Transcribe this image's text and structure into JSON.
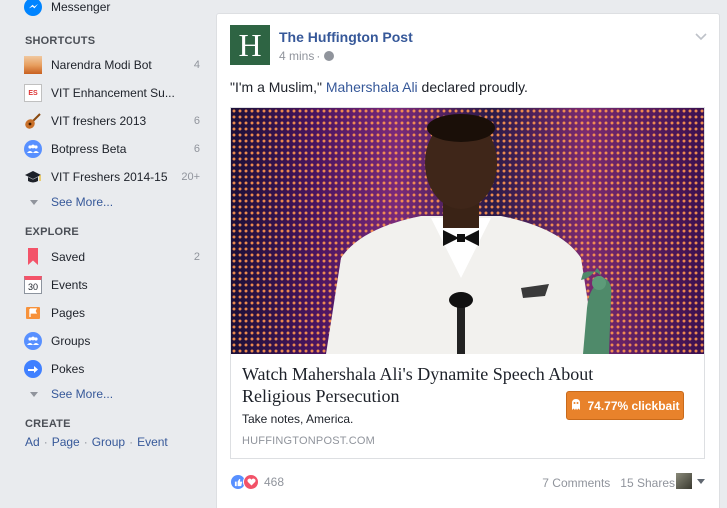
{
  "sidebar": {
    "messenger": "Messenger",
    "shortcuts_heading": "SHORTCUTS",
    "shortcuts": [
      {
        "label": "Narendra Modi Bot",
        "count": "4",
        "icon": "modi-avatar-icon"
      },
      {
        "label": "VIT Enhancement Su...",
        "count": "",
        "icon": "es-logo-icon"
      },
      {
        "label": "VIT freshers 2013",
        "count": "6",
        "icon": "guitar-icon"
      },
      {
        "label": "Botpress Beta",
        "count": "6",
        "icon": "group-icon"
      },
      {
        "label": "VIT Freshers 2014-15",
        "count": "20+",
        "icon": "graduation-cap-icon"
      }
    ],
    "see_more_1": "See More...",
    "explore_heading": "EXPLORE",
    "explore": [
      {
        "label": "Saved",
        "count": "2",
        "icon": "bookmark-icon"
      },
      {
        "label": "Events",
        "count": "",
        "icon": "calendar-icon",
        "calendar_day": "30"
      },
      {
        "label": "Pages",
        "count": "",
        "icon": "flag-icon"
      },
      {
        "label": "Groups",
        "count": "",
        "icon": "groups-icon"
      },
      {
        "label": "Pokes",
        "count": "",
        "icon": "poke-icon"
      }
    ],
    "see_more_2": "See More...",
    "create_heading": "CREATE",
    "create_links": [
      "Ad",
      "Page",
      "Group",
      "Event"
    ],
    "create_separator": "·"
  },
  "post": {
    "page_name": "The Huffington Post",
    "avatar_letter": "H",
    "time": "4 mins",
    "text_before": "\"I'm a Muslim,\" ",
    "mention": "Mahershala Ali",
    "text_after": " declared proudly.",
    "link": {
      "title": "Watch Mahershala Ali's Dynamite Speech About Religious Persecution",
      "description": "Take notes, America.",
      "domain": "HUFFINGTONPOST.COM"
    },
    "clickbait_label": "74.77% clickbait",
    "reactions_count": "468",
    "comments": "7 Comments",
    "shares": "15 Shares"
  },
  "colors": {
    "link_blue": "#365899",
    "huffpost_green": "#2e6443",
    "clickbait_orange": "#e8822b",
    "like_blue": "#5890ff",
    "love_red": "#f25268"
  }
}
